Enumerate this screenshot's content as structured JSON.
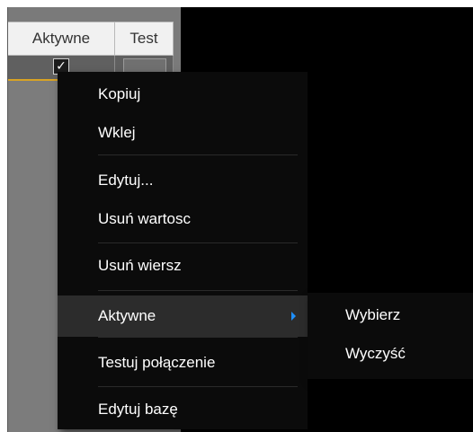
{
  "grid": {
    "columns": [
      "Aktywne",
      "Test"
    ],
    "row": {
      "aktywne_checked": true,
      "check_glyph": "✓"
    },
    "selected_row_border_color": "#d8a324"
  },
  "context_menu": {
    "items": [
      {
        "label": "Kopiuj"
      },
      {
        "label": "Wklej"
      },
      {
        "label": "Edytuj..."
      },
      {
        "label": "Usuń wartosc"
      },
      {
        "label": "Usuń wiersz"
      },
      {
        "label": "Aktywne",
        "has_submenu": true,
        "highlighted": true
      },
      {
        "label": "Testuj połączenie"
      },
      {
        "label": "Edytuj bazę"
      }
    ],
    "submenu_arrow_color": "#1e90ff"
  },
  "submenu": {
    "items": [
      {
        "label": "Wybierz"
      },
      {
        "label": "Wyczyść"
      }
    ]
  }
}
